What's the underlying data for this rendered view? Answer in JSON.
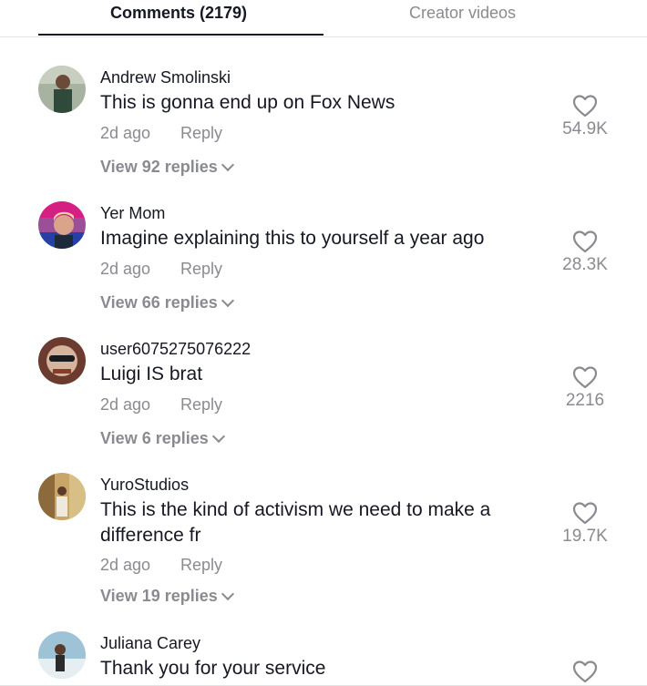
{
  "tabs": {
    "comments_label": "Comments (2179)",
    "creator_label": "Creator videos"
  },
  "comments": [
    {
      "username": "Andrew Smolinski",
      "text": "This is gonna end up on Fox News",
      "time": "2d ago",
      "reply": "Reply",
      "view_replies": "View 92 replies",
      "likes": "54.9K",
      "avatar_icon": "user-photo-icon"
    },
    {
      "username": "Yer  Mom",
      "text": "Imagine explaining this to yourself a year ago",
      "time": "2d ago",
      "reply": "Reply",
      "view_replies": "View 66 replies",
      "likes": "28.3K",
      "avatar_icon": "user-photo-icon"
    },
    {
      "username": "user6075275076222",
      "text": "Luigi IS brat",
      "time": "2d ago",
      "reply": "Reply",
      "view_replies": "View 6 replies",
      "likes": "2216",
      "avatar_icon": "user-photo-icon"
    },
    {
      "username": "YuroStudios",
      "text": "This is the kind of activism we need to make a difference fr",
      "time": "2d ago",
      "reply": "Reply",
      "view_replies": "View 19 replies",
      "likes": "19.7K",
      "avatar_icon": "user-photo-icon"
    },
    {
      "username": "Juliana Carey",
      "text": "Thank you for your service",
      "avatar_icon": "user-photo-icon"
    }
  ],
  "colors": {
    "primary_text": "#161823",
    "secondary_text": "#8a8b91",
    "divider": "#e3e3e4"
  }
}
